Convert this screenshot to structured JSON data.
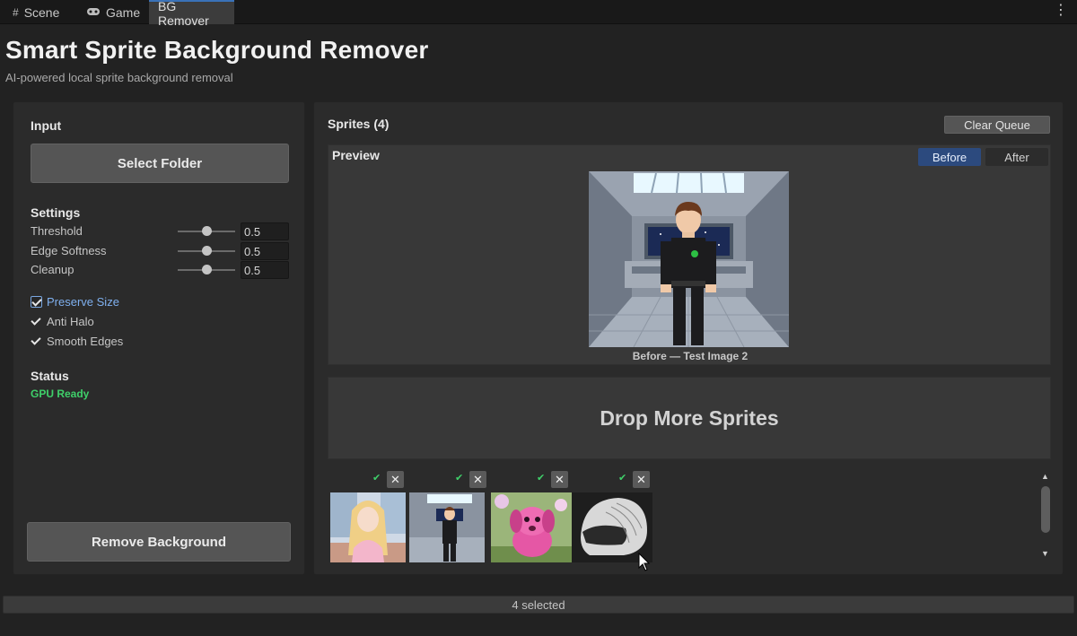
{
  "tabs": [
    {
      "label": "Scene",
      "icon": "grid-icon"
    },
    {
      "label": "Game",
      "icon": "gamepad-icon"
    },
    {
      "label": "BG Remover",
      "icon": ""
    }
  ],
  "header": {
    "title": "Smart Sprite Background Remover",
    "subtitle": "AI-powered local sprite background removal"
  },
  "left_panel": {
    "input_label": "Input",
    "select_folder": "Select Folder",
    "settings_label": "Settings",
    "settings": [
      {
        "label": "Threshold",
        "value": "0.5",
        "level": 0.5
      },
      {
        "label": "Edge Softness",
        "value": "0.5",
        "level": 0.5
      },
      {
        "label": "Cleanup",
        "value": "0.5",
        "level": 0.5
      }
    ],
    "options": [
      {
        "label": "Preserve Size",
        "checked": true
      },
      {
        "label": "Anti Halo",
        "checked": true
      },
      {
        "label": "Smooth Edges",
        "checked": true
      }
    ],
    "status_label": "Status",
    "status_value": "GPU Ready",
    "remove_button": "Remove Background"
  },
  "right_panel": {
    "sprites_title": "Sprites (4)",
    "clear_queue": "Clear Queue",
    "preview": {
      "title": "Preview",
      "before": "Before",
      "after": "After",
      "caption": "Before  —  Test Image 2"
    },
    "drop_zone": "Drop More Sprites",
    "thumbnails": [
      {
        "name": "anime-girl-thumbnail",
        "done": true
      },
      {
        "name": "space-character-thumbnail",
        "done": true
      },
      {
        "name": "pink-puppy-thumbnail",
        "done": true
      },
      {
        "name": "helmet-thumbnail",
        "done": true
      }
    ]
  },
  "status_bar": {
    "text": "4 selected"
  },
  "colors": {
    "accent": "#2c4a7e",
    "ready": "#3fd06a",
    "panel": "#2b2b2b",
    "background": "#222222"
  }
}
